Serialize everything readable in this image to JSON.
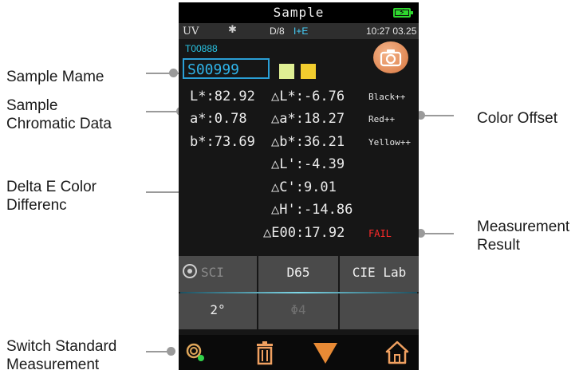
{
  "callouts": {
    "sample_name": "Sample Mame",
    "chromatic_line1": "Sample",
    "chromatic_line2": "Chromatic Data",
    "delta_e_line1": "Delta E Color",
    "delta_e_line2": "Differenc",
    "switch_line1": "Switch Standard",
    "switch_line2": "Measurement",
    "color_offset": "Color Offset",
    "result_line1": "Measurement",
    "result_line2": "Result"
  },
  "device": {
    "title": "Sample",
    "status": {
      "uv": "UV",
      "geometry": "D/8",
      "mode": "I+E",
      "clock": "10:27 03.25"
    },
    "standard_name": "T00888",
    "sample_name": "S00999",
    "swatches": [
      "#dfef94",
      "#f2cd2e"
    ],
    "lab": {
      "L": "L*:82.92",
      "a": "a*:0.78",
      "b": "b*:73.69"
    },
    "delta": {
      "dL": "△L*:-6.76",
      "da": "△a*:18.27",
      "db": "△b*:36.21",
      "dL2": "△L':-4.39",
      "dC": "△C':9.01",
      "dH": "△H':-14.86",
      "dE": "△E00:17.92"
    },
    "offsets": {
      "L": "Black++",
      "a": "Red++",
      "b": "Yellow++"
    },
    "result": "FAIL",
    "buttons": {
      "sci": "SCI",
      "illuminant": "D65",
      "space": "CIE Lab",
      "observer": "2°",
      "aperture": "Φ4"
    },
    "icons": [
      "camera-icon",
      "battery-icon",
      "bluetooth-icon",
      "sci-icon",
      "switch-standard-icon",
      "trash-icon",
      "triangle-down-icon",
      "home-icon"
    ],
    "accent_color": "#2fb4ea",
    "fail_color": "#ff2a2a"
  }
}
